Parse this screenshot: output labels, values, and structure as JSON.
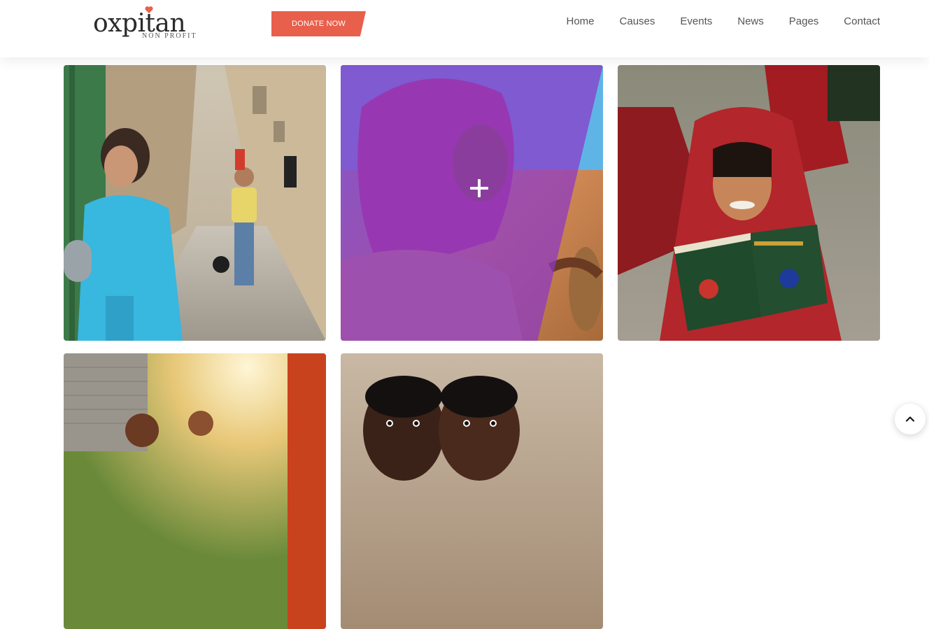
{
  "brand": {
    "name": "oxpitan",
    "tagline": "NON PROFIT",
    "heart_color": "#e8604c"
  },
  "header": {
    "donate_label": "DONATE NOW",
    "accent": "#e8604c"
  },
  "nav": {
    "items": [
      {
        "label": "Home"
      },
      {
        "label": "Causes"
      },
      {
        "label": "Events"
      },
      {
        "label": "News"
      },
      {
        "label": "Pages"
      },
      {
        "label": "Contact"
      }
    ]
  },
  "gallery": {
    "overlay_color": "#8c37c8",
    "items": [
      {
        "icon": "photo-girl-street"
      },
      {
        "icon": "photo-girl-purple-scarf",
        "hovered": true,
        "action_icon": "plus-icon"
      },
      {
        "icon": "photo-monk-reading"
      },
      {
        "icon": "photo-children-sunlight"
      },
      {
        "icon": "photo-two-boys"
      }
    ]
  },
  "scroll_top": {
    "icon": "chevron-up-icon"
  }
}
